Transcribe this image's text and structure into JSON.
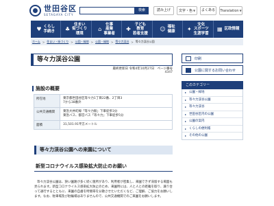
{
  "header": {
    "logo_title": "世田谷区",
    "logo_sub": "SETAGAYA CITY",
    "search_placeholder": "",
    "search_button": "検索",
    "tools": [
      {
        "label": "読み上げ"
      },
      {
        "label": "文字・色",
        "caret": "▼"
      },
      {
        "label": "よくある"
      },
      {
        "label": "Translation",
        "caret": "▼"
      }
    ]
  },
  "nav": [
    {
      "icon": "♥",
      "icon_name": "heart-icon",
      "label": "くらし\n手続き"
    },
    {
      "icon": "♣",
      "icon_name": "leaf-icon",
      "label": "住まい\n街づくり\n環境"
    },
    {
      "icon": "⌂",
      "icon_name": "building-icon",
      "label": "仕事\n産業\n事業者"
    },
    {
      "icon": "✚",
      "icon_name": "child-icon",
      "label": "子ども\n教育\n若者支援"
    },
    {
      "icon": "☺",
      "icon_name": "health-icon",
      "label": "福祉\n健康"
    },
    {
      "icon": "✦",
      "icon_name": "sports-icon",
      "label": "文化\nスポーツ\n生涯学習"
    },
    {
      "icon": "▦",
      "icon_name": "info-icon",
      "label": "区政情報"
    }
  ],
  "breadcrumb": {
    "items": [
      "ホーム",
      "住まい・街づくり",
      "公園・緑地",
      "公園・緑地",
      "等々力渓谷"
    ],
    "current": "等々力渓谷公園"
  },
  "page": {
    "title": "等々力渓谷公園",
    "updated_label": "最終更新日",
    "updated_date": "令和4年10月27日",
    "page_id_label": "ページ番号",
    "page_id": "4347"
  },
  "facility": {
    "heading": "施設の概要",
    "rows": [
      {
        "label": "所在地",
        "lines": [
          "東京都世田谷区等々力1丁目22番、2丁目3",
          "7から38番外"
        ]
      },
      {
        "label": "公共交通機関",
        "lines": [
          "東急大井町線「等々力駅」下車徒歩3分",
          "東急バス、都営バス「等々力」下車徒歩5分"
        ]
      },
      {
        "label": "面積",
        "lines": [
          "31,501.91平方メートル"
        ]
      }
    ]
  },
  "visit_heading": "等々力渓谷公園への来園について",
  "covid_heading": "新型コロナウイルス感染拡大防止のお願い",
  "notice_text": "等々力渓谷公園は、狭い園路が多く続く箇所があり、利用者が密集し、来園できず滞留する場面も見られます。新型コロナウイルス感染拡大防止のため、来園時には、人と人との距離を取り、譲り合って通行するとともに、来園の自粛を時間帯を分散させたいただくなど、ご理解、ご協力をお願いします。なお、駐車場及び駐輪場はありませんので、公共交通機関でのご来園をお願いします。",
  "sidebar": {
    "buttons": [
      {
        "label": "印刷"
      },
      {
        "label": "公園に関するお問い合わせ"
      }
    ],
    "heading": "このカテゴリー",
    "links": [
      "公園・緑地",
      "等々力渓谷公園",
      "等々力渓谷",
      "世田谷区内の公園",
      "公園の案内",
      "くらしの便利帳",
      "その他の公園"
    ]
  }
}
